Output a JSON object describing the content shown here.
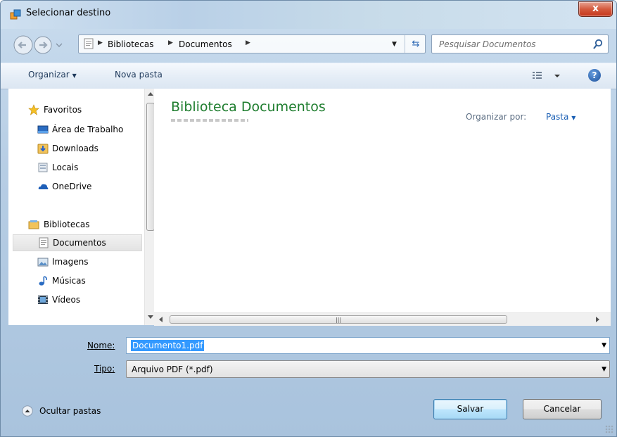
{
  "window": {
    "title": "Selecionar destino",
    "close_label": "x"
  },
  "address_bar": {
    "crumbs": [
      "Bibliotecas",
      "Documentos"
    ],
    "separator": "▶"
  },
  "search": {
    "placeholder": "Pesquisar Documentos"
  },
  "toolbar": {
    "organize_label": "Organizar",
    "new_folder_label": "Nova pasta",
    "help_label": "?"
  },
  "nav_pane": {
    "favorites_header": "Favoritos",
    "favorites": [
      {
        "label": "Área de Trabalho",
        "icon": "desktop-icon"
      },
      {
        "label": "Downloads",
        "icon": "downloads-icon"
      },
      {
        "label": "Locais",
        "icon": "recent-places-icon"
      },
      {
        "label": "OneDrive",
        "icon": "onedrive-icon"
      }
    ],
    "libraries_header": "Bibliotecas",
    "libraries": [
      {
        "label": "Documentos",
        "icon": "documents-icon",
        "selected": true
      },
      {
        "label": "Imagens",
        "icon": "pictures-icon"
      },
      {
        "label": "Músicas",
        "icon": "music-icon"
      },
      {
        "label": "Vídeos",
        "icon": "videos-icon"
      }
    ]
  },
  "content": {
    "library_title": "Biblioteca Documentos",
    "arrange_by_label": "Organizar por:",
    "arrange_by_value": "Pasta"
  },
  "form": {
    "name_label": "Nome:",
    "name_value": "Documento1.pdf",
    "type_label": "Tipo:",
    "type_value": "Arquivo PDF (*.pdf)"
  },
  "footer": {
    "hide_folders_label": "Ocultar pastas",
    "save_label": "Salvar",
    "cancel_label": "Cancelar"
  },
  "colors": {
    "library_title": "#1e7d2e",
    "selection": "#3399ff",
    "close_button": "#c4371c",
    "link_blue": "#1a5fb4"
  }
}
